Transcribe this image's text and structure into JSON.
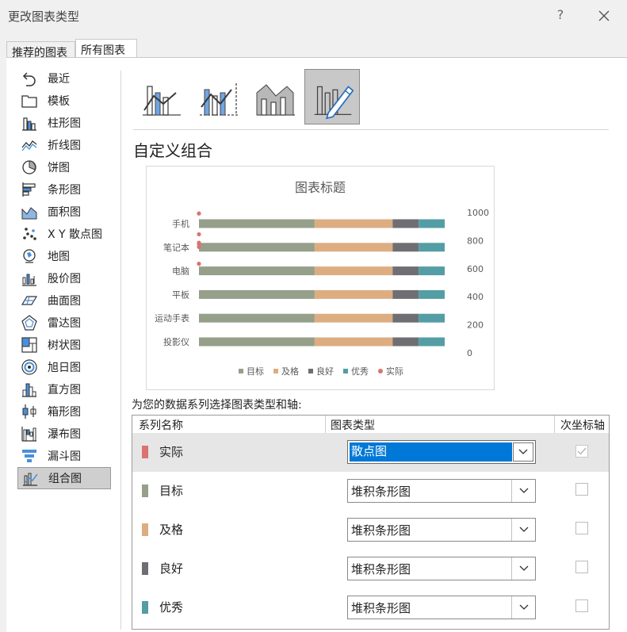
{
  "dialog": {
    "title": "更改图表类型",
    "help_label": "?"
  },
  "tabs": [
    {
      "label": "推荐的图表"
    },
    {
      "label": "所有图表"
    }
  ],
  "nav": [
    {
      "label": "最近",
      "icon": "recent-icon"
    },
    {
      "label": "模板",
      "icon": "template-folder-icon"
    },
    {
      "label": "柱形图",
      "icon": "column-chart-icon"
    },
    {
      "label": "折线图",
      "icon": "line-chart-icon"
    },
    {
      "label": "饼图",
      "icon": "pie-chart-icon"
    },
    {
      "label": "条形图",
      "icon": "bar-chart-icon"
    },
    {
      "label": "面积图",
      "icon": "area-chart-icon"
    },
    {
      "label": "X Y 散点图",
      "icon": "scatter-chart-icon"
    },
    {
      "label": "地图",
      "icon": "map-chart-icon"
    },
    {
      "label": "股价图",
      "icon": "stock-chart-icon"
    },
    {
      "label": "曲面图",
      "icon": "surface-chart-icon"
    },
    {
      "label": "雷达图",
      "icon": "radar-chart-icon"
    },
    {
      "label": "树状图",
      "icon": "treemap-chart-icon"
    },
    {
      "label": "旭日图",
      "icon": "sunburst-chart-icon"
    },
    {
      "label": "直方图",
      "icon": "histogram-chart-icon"
    },
    {
      "label": "箱形图",
      "icon": "box-whisker-chart-icon"
    },
    {
      "label": "瀑布图",
      "icon": "waterfall-chart-icon"
    },
    {
      "label": "漏斗图",
      "icon": "funnel-chart-icon"
    },
    {
      "label": "组合图",
      "icon": "combo-chart-icon",
      "selected": true
    }
  ],
  "combo_title": "自定义组合",
  "chart_data": {
    "type": "bar",
    "title": "图表标题",
    "orientation": "horizontal-stacked",
    "categories": [
      "手机",
      "笔记本",
      "电脑",
      "平板",
      "运动手表",
      "投影仪"
    ],
    "series": [
      {
        "name": "目标",
        "values": [
          4,
          4,
          4,
          4,
          4,
          4
        ],
        "color": "#959f8a"
      },
      {
        "name": "及格",
        "values": [
          2.7,
          2.7,
          2.7,
          2.7,
          2.7,
          2.7
        ],
        "color": "#ddad82"
      },
      {
        "name": "良好",
        "values": [
          0.9,
          0.9,
          0.9,
          0.9,
          0.9,
          0.9
        ],
        "color": "#6f6f73"
      },
      {
        "name": "优秀",
        "values": [
          0.9,
          0.9,
          0.9,
          0.9,
          0.9,
          0.9
        ],
        "color": "#549da5"
      },
      {
        "name": "实际",
        "type": "scatter",
        "values": [
          993,
          845,
          785,
          775,
          755,
          635
        ],
        "color": "#d9736f"
      }
    ],
    "secondary_axis": {
      "ticks": [
        "1000",
        "800",
        "600",
        "400",
        "200",
        "0"
      ],
      "ylim": [
        0,
        1000
      ]
    },
    "legend_position": "bottom",
    "grid": false
  },
  "instruction": "为您的数据系列选择图表类型和轴:",
  "table": {
    "col1": "系列名称",
    "col2": "图表类型",
    "col3": "次坐标轴",
    "rows": [
      {
        "name": "实际",
        "color": "#d9736f",
        "type": "散点图",
        "secondary": true,
        "selected": true
      },
      {
        "name": "目标",
        "color": "#959f8a",
        "type": "堆积条形图",
        "secondary": false
      },
      {
        "name": "及格",
        "color": "#ddad82",
        "type": "堆积条形图",
        "secondary": false
      },
      {
        "name": "良好",
        "color": "#6f6f73",
        "type": "堆积条形图",
        "secondary": false
      },
      {
        "name": "优秀",
        "color": "#549da5",
        "type": "堆积条形图",
        "secondary": false
      }
    ]
  }
}
